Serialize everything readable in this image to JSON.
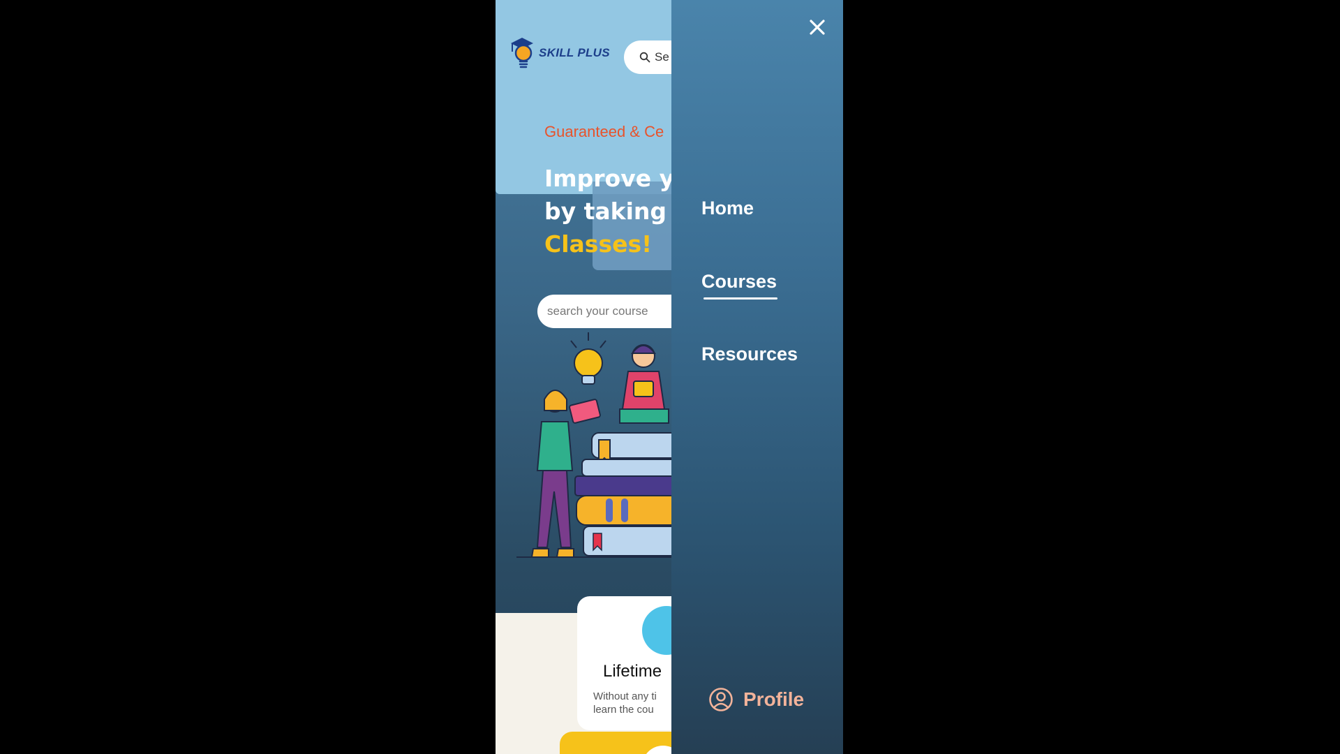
{
  "brand": {
    "name": "SKILL PLUS",
    "logo_icon": "lightbulb-graduation-cap-icon"
  },
  "header": {
    "search_text": "Se",
    "search_icon": "search-icon"
  },
  "hero": {
    "tagline": "Guaranteed & Ce",
    "line1": "Improve y",
    "line2": "by taking",
    "line3": "Classes!",
    "search_placeholder": "search your course"
  },
  "feature": {
    "title": "Lifetime",
    "desc_line1": "Without any ti",
    "desc_line2": "learn the cou"
  },
  "drawer": {
    "close_icon": "close-icon",
    "items": [
      {
        "label": "Home",
        "active": false
      },
      {
        "label": "Courses",
        "active": true
      },
      {
        "label": "Resources",
        "active": false
      }
    ],
    "profile_label": "Profile",
    "profile_icon": "user-circle-icon"
  },
  "colors": {
    "accent_yellow": "#f6c21a",
    "tagline_orange": "#e8532b",
    "profile_peach": "#f2b39a",
    "brand_blue": "#1c3e8a"
  }
}
